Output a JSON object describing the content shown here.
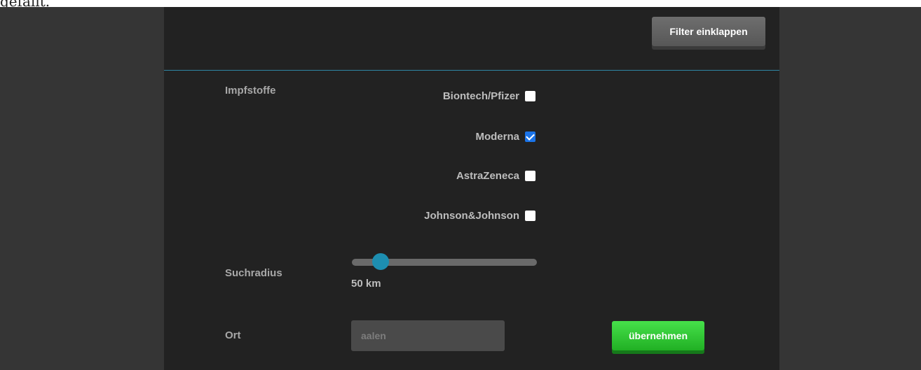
{
  "top_text": "gefällt.",
  "header": {
    "collapse_button_label": "Filter einklappen"
  },
  "vaccines": {
    "label": "Impfstoffe",
    "items": [
      {
        "label": "Biontech/Pfizer",
        "checked": false
      },
      {
        "label": "Moderna",
        "checked": true
      },
      {
        "label": "AstraZeneca",
        "checked": false
      },
      {
        "label": "Johnson&Johnson",
        "checked": false
      }
    ]
  },
  "radius": {
    "label": "Suchradius",
    "value_text": "50 km",
    "value_km": 50,
    "fraction": 0.12
  },
  "location": {
    "label": "Ort",
    "placeholder": "aalen"
  },
  "apply_button_label": "übernehmen",
  "colors": {
    "accent": "#1d8eb0",
    "divider": "#2f87a5",
    "apply": "#2ecc40",
    "panel": "#222222",
    "page": "#353535"
  }
}
